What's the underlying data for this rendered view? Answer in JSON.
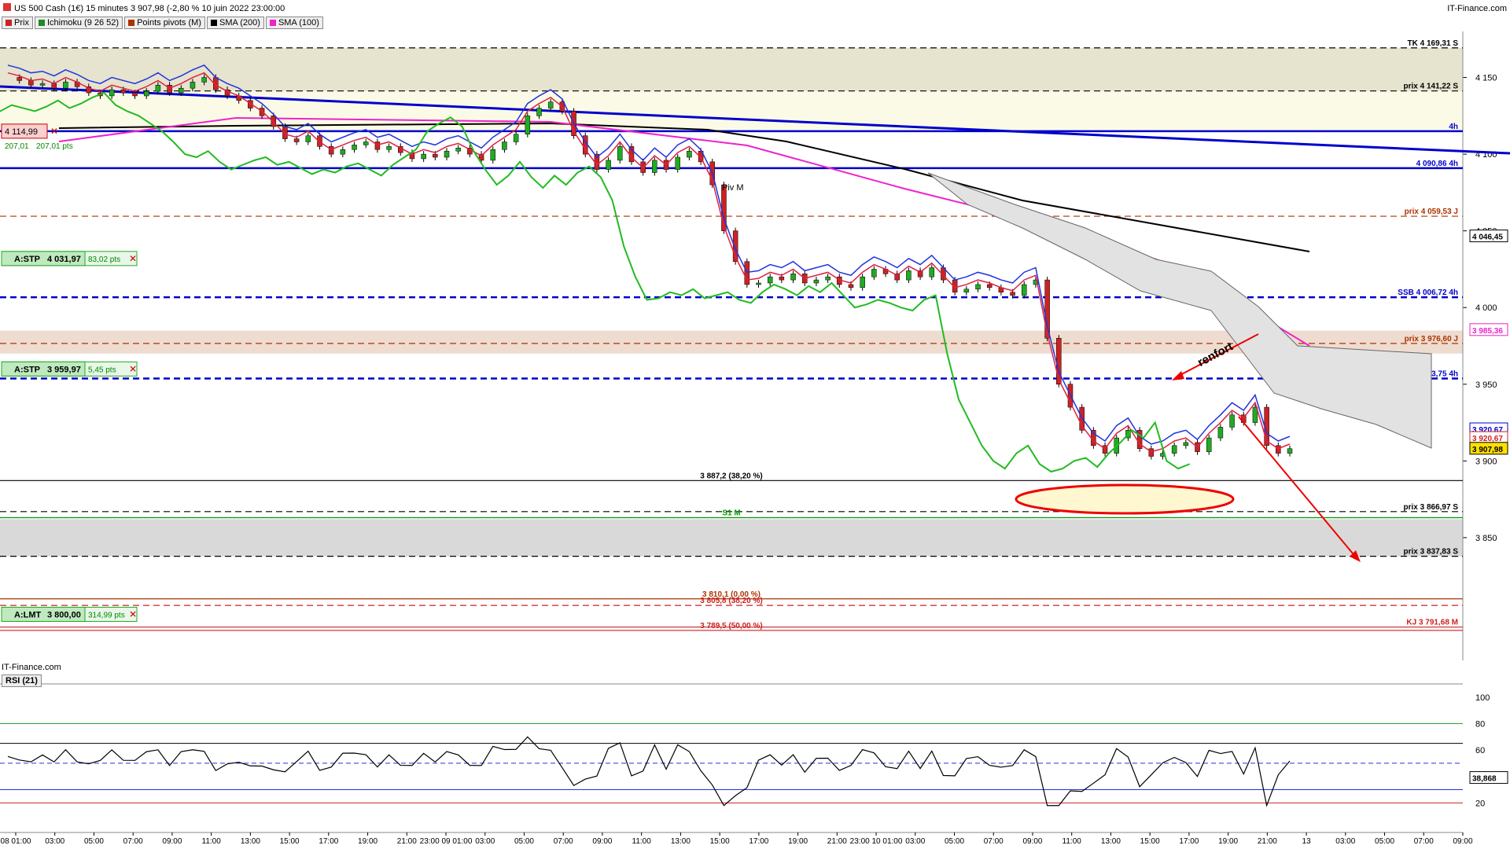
{
  "window": {
    "title": "US 500 Cash (1€) 15 minutes 3 907,98 (-2,80 % 10 juin 2022 23:00:00",
    "brand": "IT-Finance.com",
    "watermark": "IT-Finance.com"
  },
  "legend": [
    {
      "label": "Prix",
      "color": "#cc2222"
    },
    {
      "label": "Ichimoku (9 26 52)",
      "color": "#228822"
    },
    {
      "label": "Points pivots (M)",
      "color": "#aa3300"
    },
    {
      "label": "SMA (200)",
      "color": "#000000"
    },
    {
      "label": "SMA (100)",
      "color": "#ee22cc"
    }
  ],
  "rsi_label": "RSI (21)",
  "chart_data": {
    "type": "candlestick",
    "y_axis": {
      "min": 3770,
      "max": 4180,
      "ticks": [
        4150,
        4100,
        4050,
        4000,
        3950,
        3900,
        3850
      ],
      "tick_labels": [
        "4 150",
        "4 100",
        "4 050",
        "4 000",
        "3 950",
        "3 900",
        "3 850"
      ]
    },
    "x_ticks": [
      "08 01:00",
      "03:00",
      "05:00",
      "07:00",
      "09:00",
      "11:00",
      "13:00",
      "15:00",
      "17:00",
      "19:00",
      "21:00",
      "23:00 09 01:00",
      "03:00",
      "05:00",
      "07:00",
      "09:00",
      "11:00",
      "13:00",
      "15:00",
      "17:00",
      "19:00",
      "21:00",
      "23:00 10 01:00",
      "03:00",
      "05:00",
      "07:00",
      "09:00",
      "11:00",
      "13:00",
      "15:00",
      "17:00",
      "19:00",
      "21:00",
      "13",
      "03:00",
      "05:00",
      "07:00",
      "09:00"
    ],
    "levels": [
      {
        "label": "TK 4 169,31 S",
        "value": 4169.31,
        "color": "#000000",
        "style": "dash"
      },
      {
        "label": "prix 4 141,22 S",
        "value": 4141.22,
        "color": "#000000",
        "style": "dash"
      },
      {
        "label": "4h",
        "value": 4115,
        "color": "#0000cc",
        "style": "solid"
      },
      {
        "label": "4 090,86 4h",
        "value": 4090.86,
        "color": "#0000cc",
        "style": "solid"
      },
      {
        "label": "prix 4 059,53 J",
        "value": 4059.53,
        "color": "#aa3300",
        "style": "dash"
      },
      {
        "label": "SSB 4 006,72 4h",
        "value": 4006.72,
        "color": "#0000cc",
        "style": "dash"
      },
      {
        "label": "prix 3 976,60 J",
        "value": 3976.6,
        "color": "#aa3300",
        "style": "dash"
      },
      {
        "label": "SSB (ancienne ZE) 3 953,75 4h",
        "value": 3953.75,
        "color": "#0000cc",
        "style": "dash"
      },
      {
        "label": "3 887,2 (38,20 %)",
        "value": 3887.2,
        "color": "#000000",
        "style": "solid"
      },
      {
        "label": "prix 3 866,97 S",
        "value": 3866.97,
        "color": "#000000",
        "style": "dash"
      },
      {
        "label": "S1 M",
        "value": 3863,
        "color": "#009900",
        "style": "solid"
      },
      {
        "label": "prix 3 837,83 S",
        "value": 3837.83,
        "color": "#000000",
        "style": "dash"
      },
      {
        "label": "3 810,1 (0,00 %)",
        "value": 3810.1,
        "color": "#aa3300",
        "style": "solid"
      },
      {
        "label": "3 805,8 (38,20 %)",
        "value": 3805.8,
        "color": "#cc2222",
        "style": "dash"
      },
      {
        "label": "3 789,5 (50,00 %)",
        "value": 3789.5,
        "color": "#cc2222",
        "style": "solid"
      },
      {
        "label": "KJ 3 791,68 M",
        "value": 3791.68,
        "color": "#cc2222",
        "style": "solid"
      }
    ],
    "order_tags": [
      {
        "label": "A:STP",
        "price": "4 031,97",
        "pts": "83,02 pts",
        "value": 4031.97
      },
      {
        "label": "A:STP",
        "price": "3 959,97",
        "pts": "5,45 pts",
        "value": 3959.97
      },
      {
        "label": "A:LMT",
        "price": "3 800,00",
        "pts": "314,99 pts",
        "value": 3800.0
      }
    ],
    "price_tags": [
      {
        "label": "4 114,99",
        "sub": "207,01",
        "sub2": "207,01 pts",
        "value": 4114.99
      }
    ],
    "right_tags": [
      {
        "label": "4 046,45",
        "value": 4046.45,
        "color": "#000000",
        "bg": "#ffffff"
      },
      {
        "label": "3 985,36",
        "value": 3985.36,
        "color": "#ee22cc",
        "bg": "#ffffff"
      },
      {
        "label": "3 920,67",
        "value": 3920.67,
        "color": "#0000cc",
        "bg": "#ffffff"
      },
      {
        "label": "3 920,67",
        "value": 3915,
        "color": "#cc2222",
        "bg": "#ffffff"
      },
      {
        "label": "3 907,98",
        "value": 3907.98,
        "color": "#000000",
        "bg": "#ffe000"
      }
    ],
    "annotations": [
      {
        "text": "renfort"
      },
      {
        "text": "Piv M"
      }
    ],
    "rsi": {
      "y_ticks": [
        "100",
        "80",
        "60",
        "20"
      ],
      "last": "38,868",
      "bands": [
        80,
        50,
        30,
        20
      ]
    },
    "price_path": [
      4150,
      4148,
      4145,
      4146,
      4143,
      4147,
      4144,
      4140,
      4138,
      4142,
      4140,
      4138,
      4141,
      4145,
      4140,
      4143,
      4147,
      4150,
      4142,
      4138,
      4135,
      4130,
      4125,
      4118,
      4110,
      4108,
      4112,
      4105,
      4100,
      4103,
      4106,
      4108,
      4103,
      4105,
      4101,
      4097,
      4100,
      4098,
      4102,
      4104,
      4100,
      4096,
      4103,
      4108,
      4113,
      4125,
      4130,
      4134,
      4128,
      4112,
      4100,
      4090,
      4096,
      4105,
      4095,
      4088,
      4096,
      4090,
      4098,
      4102,
      4095,
      4080,
      4050,
      4030,
      4015,
      4016,
      4020,
      4018,
      4022,
      4016,
      4018,
      4020,
      4015,
      4013,
      4020,
      4025,
      4022,
      4018,
      4024,
      4020,
      4026,
      4018,
      4010,
      4012,
      4015,
      4013,
      4010,
      4008,
      4015,
      4018,
      3980,
      3950,
      3935,
      3920,
      3910,
      3905,
      3915,
      3920,
      3908,
      3903,
      3905,
      3910,
      3912,
      3906,
      3915,
      3922,
      3930,
      3925,
      3935,
      3910,
      3905,
      3908
    ]
  }
}
